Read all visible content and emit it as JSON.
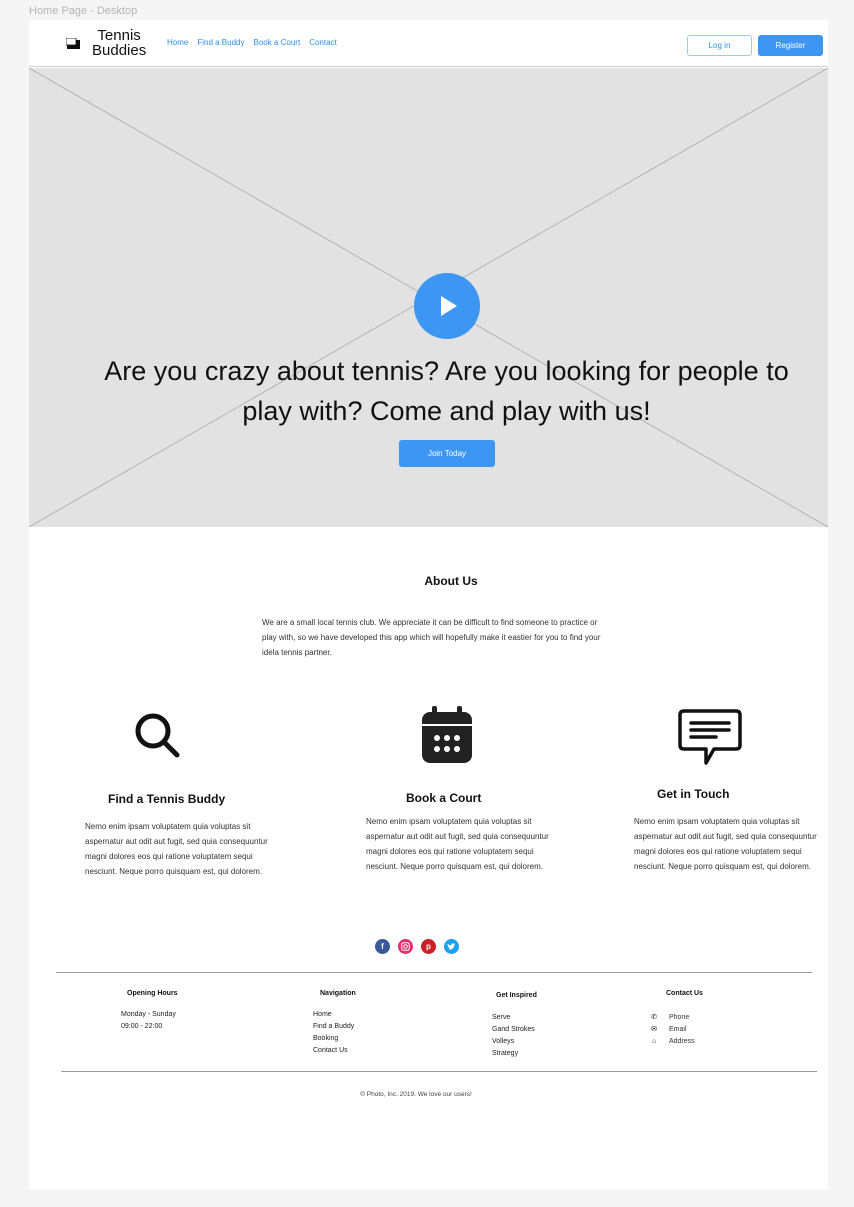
{
  "canvas_label": "Home Page - Desktop",
  "header": {
    "logo_line1": "Tennis",
    "logo_line2": "Buddies",
    "nav": [
      "Home",
      "Find a  Buddy",
      "Book a Court",
      "Contact"
    ],
    "login_label": "Log in",
    "register_label": "Register"
  },
  "hero": {
    "headline": "Are you crazy about tennis? Are you looking for people to play with? Come and play with us!",
    "cta_label": "Join Today",
    "accent_color": "#3d96f2"
  },
  "about": {
    "title": "About Us",
    "text": "We are a small local tennis club. We appreciate it can be difficult to find someone to practice or play with, so we have developed this app which will hopefully make it eastier for you to find your idela tennis partner."
  },
  "features": [
    {
      "icon": "search-icon",
      "title": "Find a Tennis Buddy",
      "text": "Nemo enim ipsam voluptatem quia voluptas sit aspernatur aut odit aut fugit, sed quia consequuntur magni dolores eos qui ratione voluptatem sequi nesciunt. Neque porro quisquam est, qui dolorem."
    },
    {
      "icon": "calendar-icon",
      "title": "Book a Court",
      "text": "Nemo enim ipsam voluptatem quia voluptas sit aspernatur aut odit aut fugit, sed quia consequuntur magni dolores eos qui ratione voluptatem sequi nesciunt. Neque porro quisquam est, qui dolorem."
    },
    {
      "icon": "chat-icon",
      "title": "Get in Touch",
      "text": "Nemo enim ipsam voluptatem quia voluptas sit aspernatur aut odit aut fugit, sed quia consequuntur magni dolores eos qui ratione voluptatem sequi nesciunt. Neque porro quisquam est, qui dolorem."
    }
  ],
  "social": [
    {
      "icon": "facebook-icon",
      "color": "#3b5998"
    },
    {
      "icon": "instagram-icon",
      "color": "#e1306c"
    },
    {
      "icon": "pinterest-icon",
      "color": "#cb2027"
    },
    {
      "icon": "twitter-icon",
      "color": "#1da1f2"
    }
  ],
  "footer": {
    "opening_hours": {
      "title": "Opening Hours",
      "lines": [
        "Monday - Sunday",
        "09:00 - 22:00"
      ]
    },
    "navigation": {
      "title": "Navigation",
      "items": [
        "Home",
        "Find a Buddy",
        "Booking",
        "Contact Us"
      ]
    },
    "inspired": {
      "title": "Get Inspired",
      "items": [
        "Serve",
        "Gand Strokes",
        "Volleys",
        "Strategy"
      ]
    },
    "contact": {
      "title": "Contact Us",
      "items": [
        {
          "icon": "phone-icon",
          "label": "Phone"
        },
        {
          "icon": "mail-icon",
          "label": "Email"
        },
        {
          "icon": "address-icon",
          "label": "Address"
        }
      ]
    },
    "copyright": "© Photo, Inc. 2019. We love our users!"
  }
}
